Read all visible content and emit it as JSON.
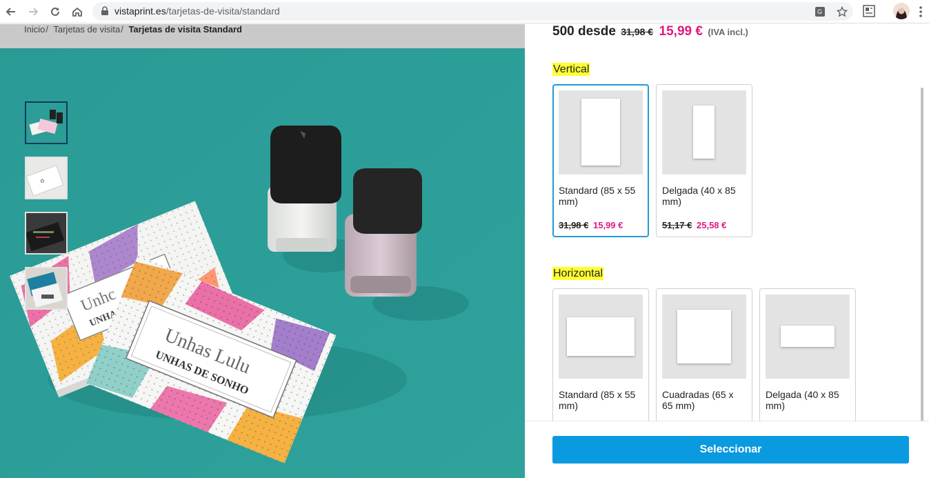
{
  "browser": {
    "url_host": "vistaprint.es",
    "url_path": "/tarjetas-de-visita/standard"
  },
  "breadcrumb": {
    "items": [
      "Inicio",
      "Tarjetas de visita"
    ],
    "current": "Tarjetas de visita Standard"
  },
  "product_photo": {
    "card_texts": [
      "Unhas Lulu",
      "UNHAS DE SONHO"
    ],
    "back_card_texts": [
      "Unhc",
      "UNHAS"
    ]
  },
  "thumbnails": {
    "count": 4,
    "active_index": 0
  },
  "summary": {
    "quantity_text": "500 desde",
    "old_price": "31,98 €",
    "new_price": "15,99 €",
    "vat": "(IVA incl.)"
  },
  "sections": {
    "vertical": {
      "title": "Vertical",
      "options": [
        {
          "label": "Standard (85 x 55 mm)",
          "old_price": "31,98 €",
          "new_price": "15,99 €"
        },
        {
          "label": "Delgada (40 x 85 mm)",
          "old_price": "51,17 €",
          "new_price": "25,58 €"
        }
      ]
    },
    "horizontal": {
      "title": "Horizontal",
      "options": [
        {
          "label": "Standard (85 x 55 mm)"
        },
        {
          "label": "Cuadradas (65 x 65 mm)"
        },
        {
          "label": "Delgada (40 x 85 mm)"
        }
      ]
    }
  },
  "footer": {
    "select_label": "Seleccionar"
  },
  "colors": {
    "accent_pink": "#e0197d",
    "button_blue": "#0a9ae0",
    "highlight_yellow": "#ffff33",
    "selected_border": "#1d9bd8",
    "photo_teal": "#2d9d97"
  }
}
